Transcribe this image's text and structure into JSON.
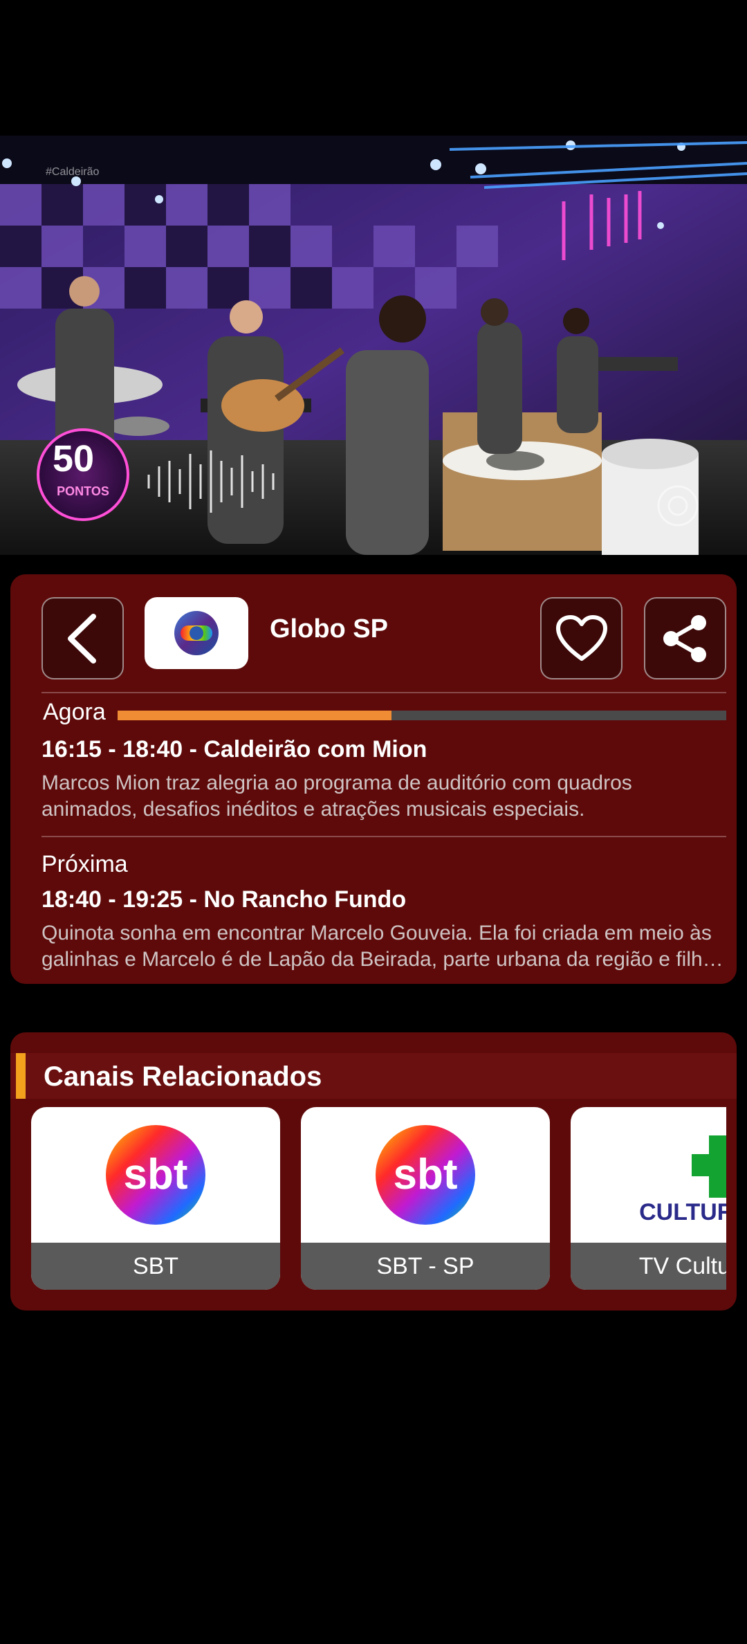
{
  "video": {
    "tag": "#Caldeirão",
    "badge_top": "50",
    "badge_bottom": "PONTOS"
  },
  "channel": {
    "name": "Globo SP"
  },
  "now": {
    "label": "Agora",
    "progress": 0.45,
    "title": "16:15 - 18:40 - Caldeirão com Mion",
    "description": "Marcos Mion traz alegria ao programa de auditório com quadros animados, desafios inéditos e atrações musicais especiais."
  },
  "next": {
    "label": "Próxima",
    "title": "18:40 - 19:25 - No Rancho Fundo",
    "description": "Quinota sonha em encontrar Marcelo Gouveia. Ela foi criada em meio às galinhas e Marcelo é de Lapão da Beirada, parte urbana da região e filho de Tia Castorina, que vive às turras com Zefa Leonel."
  },
  "related": {
    "title": "Canais Relacionados",
    "channels": [
      {
        "name": "SBT",
        "logo_text": "sbt"
      },
      {
        "name": "SBT - SP",
        "logo_text": "sbt"
      },
      {
        "name": "TV Cultura",
        "logo_text": "CULTURA"
      }
    ]
  },
  "colors": {
    "card": "#5e0a0a",
    "accent": "#f08c33",
    "header_accent": "#f3a21d"
  }
}
